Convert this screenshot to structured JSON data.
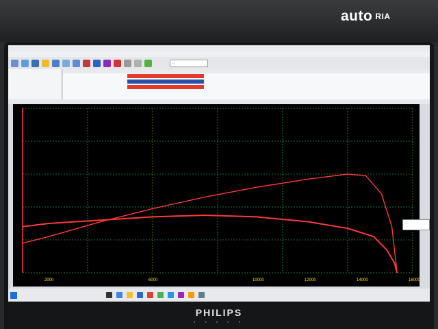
{
  "watermark": {
    "brand": "auto",
    "suffix": "RIA"
  },
  "app": {
    "toolbar_combo": "...",
    "left_panel": [
      "",
      "",
      "",
      "",
      ""
    ],
    "legend_label": "..."
  },
  "chart_data": {
    "type": "line",
    "title": "",
    "xlabel": "",
    "ylabel": "",
    "x_ticks": [
      "2000",
      "6000",
      "10000",
      "12000",
      "14000",
      "16000"
    ],
    "xlim": [
      1000,
      16000
    ],
    "grid": true,
    "series": [
      {
        "color": "#ff3a3a",
        "x": [
          1000,
          2000,
          4000,
          6000,
          8000,
          10000,
          12000,
          13500,
          14500,
          15000,
          15300,
          15400
        ],
        "y": [
          0.28,
          0.3,
          0.32,
          0.34,
          0.35,
          0.34,
          0.31,
          0.27,
          0.22,
          0.14,
          0.06,
          0.0
        ]
      },
      {
        "color": "#ff3a3a",
        "x": [
          1000,
          2000,
          4000,
          6000,
          8000,
          10000,
          12000,
          13500,
          14200,
          14800,
          15200,
          15400
        ],
        "y": [
          0.18,
          0.22,
          0.31,
          0.39,
          0.46,
          0.52,
          0.57,
          0.6,
          0.59,
          0.48,
          0.28,
          0.0
        ]
      }
    ]
  },
  "monitor": {
    "brand": "PHILIPS"
  }
}
